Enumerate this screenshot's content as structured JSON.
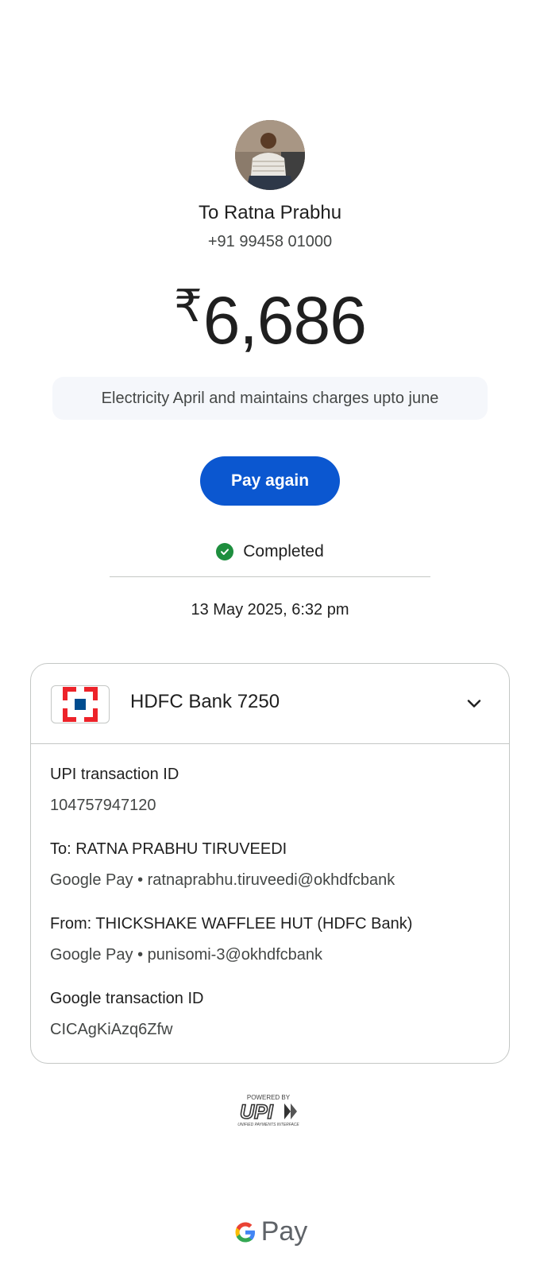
{
  "recipient": {
    "name": "To Ratna Prabhu",
    "phone": "+91 99458 01000"
  },
  "payment": {
    "currency_symbol": "₹",
    "amount": "6,686",
    "note": "Electricity April and maintains charges upto june",
    "pay_again_label": "Pay again",
    "status": "Completed",
    "datetime": "13 May 2025, 6:32 pm"
  },
  "account": {
    "bank_name": "HDFC Bank 7250",
    "bank_logo_icon": "hdfc-logo-icon"
  },
  "details": {
    "upi_label": "UPI transaction ID",
    "upi_value": "104757947120",
    "to_label": "To: RATNA PRABHU TIRUVEEDI",
    "to_value": "Google Pay • ratnaprabhu.tiruveedi@okhdfcbank",
    "from_label": "From: THICKSHAKE WAFFLEE HUT (HDFC Bank)",
    "from_value": "Google Pay • punisomi-3@okhdfcbank",
    "google_label": "Google transaction ID",
    "google_value": "CICAgKiAzq6Zfw"
  },
  "footer": {
    "powered_by": "POWERED BY",
    "upi_text": "UPI",
    "upi_sub": "UNIFIED PAYMENTS INTERFACE",
    "gpay_text": "Pay"
  },
  "colors": {
    "primary_button": "#0b57d0",
    "success": "#1e8e3e",
    "hdfc_red": "#ed232a",
    "hdfc_blue": "#004c8f"
  }
}
